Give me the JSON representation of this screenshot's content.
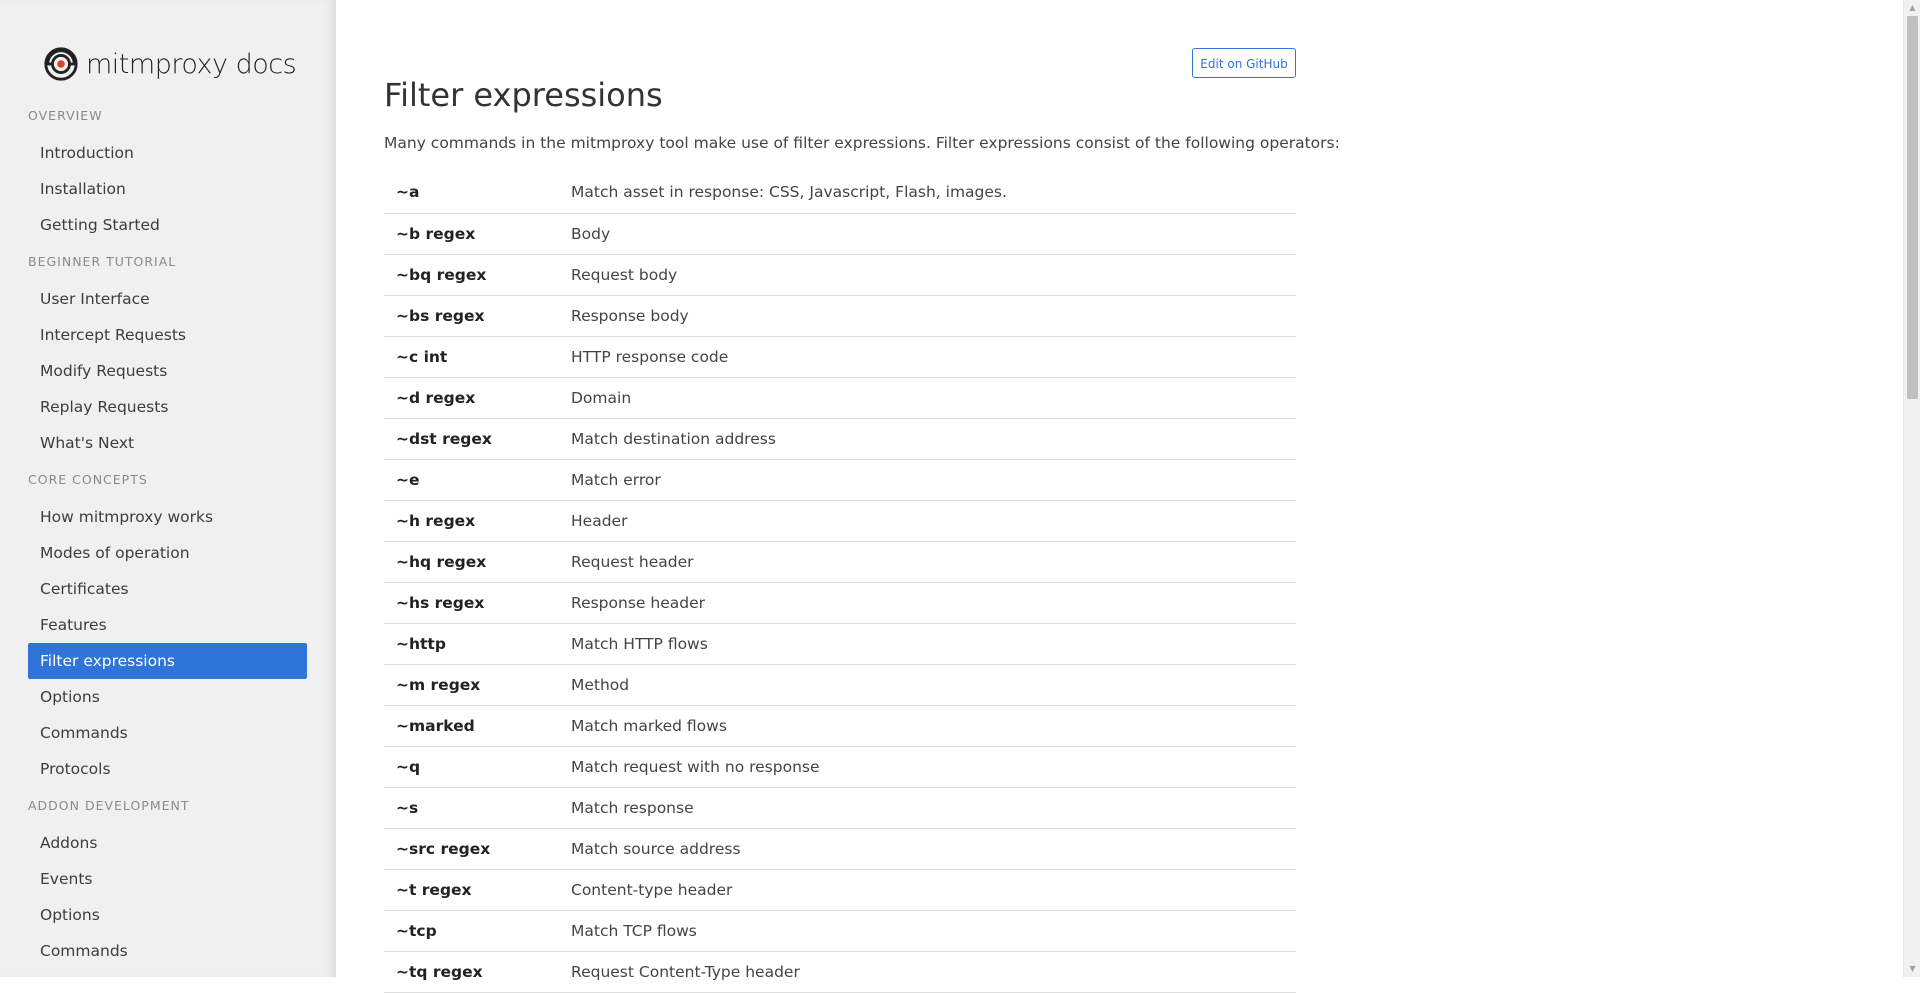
{
  "logo": {
    "text": "mitmproxy docs"
  },
  "sidebar": {
    "sections": [
      {
        "title": "Overview",
        "items": [
          {
            "label": "Introduction",
            "active": false
          },
          {
            "label": "Installation",
            "active": false
          },
          {
            "label": "Getting Started",
            "active": false
          }
        ]
      },
      {
        "title": "Beginner Tutorial",
        "items": [
          {
            "label": "User Interface",
            "active": false
          },
          {
            "label": "Intercept Requests",
            "active": false
          },
          {
            "label": "Modify Requests",
            "active": false
          },
          {
            "label": "Replay Requests",
            "active": false
          },
          {
            "label": "What's Next",
            "active": false
          }
        ]
      },
      {
        "title": "Core Concepts",
        "items": [
          {
            "label": "How mitmproxy works",
            "active": false
          },
          {
            "label": "Modes of operation",
            "active": false
          },
          {
            "label": "Certificates",
            "active": false
          },
          {
            "label": "Features",
            "active": false
          },
          {
            "label": "Filter expressions",
            "active": true
          },
          {
            "label": "Options",
            "active": false
          },
          {
            "label": "Commands",
            "active": false
          },
          {
            "label": "Protocols",
            "active": false
          }
        ]
      },
      {
        "title": "Addon Development",
        "items": [
          {
            "label": "Addons",
            "active": false
          },
          {
            "label": "Events",
            "active": false
          },
          {
            "label": "Options",
            "active": false
          },
          {
            "label": "Commands",
            "active": false
          }
        ]
      }
    ]
  },
  "header": {
    "edit_button": "Edit on GitHub"
  },
  "main": {
    "title": "Filter expressions",
    "intro": "Many commands in the mitmproxy tool make use of filter expressions. Filter expressions consist of the following operators:",
    "operators": [
      {
        "op": "~a",
        "desc": "Match asset in response: CSS, Javascript, Flash, images."
      },
      {
        "op": "~b regex",
        "desc": "Body"
      },
      {
        "op": "~bq regex",
        "desc": "Request body"
      },
      {
        "op": "~bs regex",
        "desc": "Response body"
      },
      {
        "op": "~c int",
        "desc": "HTTP response code"
      },
      {
        "op": "~d regex",
        "desc": "Domain"
      },
      {
        "op": "~dst regex",
        "desc": "Match destination address"
      },
      {
        "op": "~e",
        "desc": "Match error"
      },
      {
        "op": "~h regex",
        "desc": "Header"
      },
      {
        "op": "~hq regex",
        "desc": "Request header"
      },
      {
        "op": "~hs regex",
        "desc": "Response header"
      },
      {
        "op": "~http",
        "desc": "Match HTTP flows"
      },
      {
        "op": "~m regex",
        "desc": "Method"
      },
      {
        "op": "~marked",
        "desc": "Match marked flows"
      },
      {
        "op": "~q",
        "desc": "Match request with no response"
      },
      {
        "op": "~s",
        "desc": "Match response"
      },
      {
        "op": "~src regex",
        "desc": "Match source address"
      },
      {
        "op": "~t regex",
        "desc": "Content-type header"
      },
      {
        "op": "~tcp",
        "desc": "Match TCP flows"
      },
      {
        "op": "~tq regex",
        "desc": "Request Content-Type header"
      }
    ]
  },
  "colors": {
    "accent": "#2f74d8",
    "sidebar_bg": "#f0f0f0",
    "logo_accent": "#d9452b"
  }
}
